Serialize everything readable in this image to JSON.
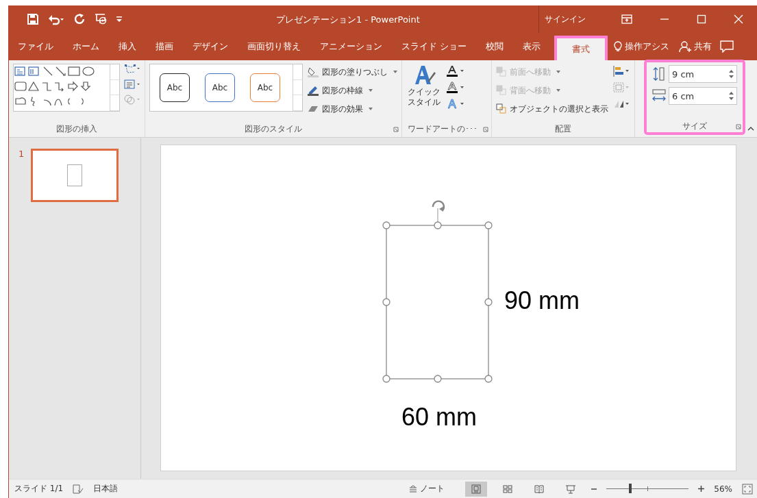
{
  "window": {
    "title": "プレゼンテーション1  -  PowerPoint",
    "sign_in": "サインイン"
  },
  "tabs": [
    {
      "label": "ファイル",
      "selected": false,
      "highlighted": false
    },
    {
      "label": "ホーム",
      "selected": false,
      "highlighted": false
    },
    {
      "label": "挿入",
      "selected": false,
      "highlighted": false
    },
    {
      "label": "描画",
      "selected": false,
      "highlighted": false
    },
    {
      "label": "デザイン",
      "selected": false,
      "highlighted": false
    },
    {
      "label": "画面切り替え",
      "selected": false,
      "highlighted": false
    },
    {
      "label": "アニメーション",
      "selected": false,
      "highlighted": false
    },
    {
      "label": "スライド ショー",
      "selected": false,
      "highlighted": false
    },
    {
      "label": "校閲",
      "selected": false,
      "highlighted": false
    },
    {
      "label": "表示",
      "selected": false,
      "highlighted": false
    },
    {
      "label": "書式",
      "selected": true,
      "highlighted": true
    }
  ],
  "tell_me": "操作アシス",
  "share": "共有",
  "ribbon": {
    "insert_shapes": {
      "label": "図形の挿入"
    },
    "shape_styles": {
      "label": "図形のスタイル",
      "samples": [
        {
          "text": "Abc",
          "color": "#262626"
        },
        {
          "text": "Abc",
          "color": "#4472c4"
        },
        {
          "text": "Abc",
          "color": "#ed7d31"
        }
      ],
      "commands": [
        "図形の塗りつぶし",
        "図形の枠線",
        "図形の効果"
      ]
    },
    "wordart": {
      "label": "ワードアートの･･･",
      "quick_style": [
        "クイック",
        "スタイル"
      ]
    },
    "arrange": {
      "label": "配置",
      "commands": [
        {
          "label": "前面へ移動",
          "disabled": true
        },
        {
          "label": "背面へ移動",
          "disabled": true
        },
        {
          "label": "オブジェクトの選択と表示",
          "disabled": false
        }
      ]
    },
    "size": {
      "label": "サイズ",
      "height": "9 cm",
      "width": "6 cm",
      "highlighted": true
    }
  },
  "thumbnails": [
    {
      "number": "1",
      "selected": true
    }
  ],
  "slide": {
    "height_label": "90 mm",
    "width_label": "60 mm"
  },
  "status_bar": {
    "slide": "スライド 1/1",
    "language": "日本語",
    "notes": "ノート",
    "views": [
      {
        "kind": "normal",
        "selected": true
      },
      {
        "kind": "sorter",
        "selected": false
      },
      {
        "kind": "reading",
        "selected": false
      },
      {
        "kind": "show",
        "selected": false
      }
    ],
    "zoom_slider": {
      "level": 0.29
    },
    "zoom": "56%"
  }
}
